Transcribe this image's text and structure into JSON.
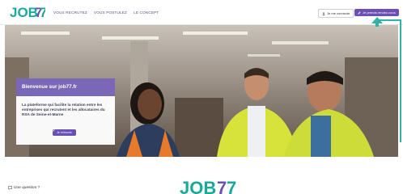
{
  "header": {
    "logo_text": "JOB77",
    "nav": [
      "VOUS RECRUTEZ",
      "VOUS POSTULEZ",
      "LE CONCEPT"
    ],
    "login_label": "Je me connecte",
    "signup_label": "Je prends rendez-vous"
  },
  "hero": {
    "card_title": "Bienvenue sur job77.fr",
    "card_text": "La plateforme qui facilite la relation entre les entreprises qui recrutent et les allocataires du RSA de Seine-et-Marne",
    "card_button": "Je m'inscris"
  },
  "footer": {
    "question_label": "Une question ?",
    "bottom_logo_text": "JOB77"
  },
  "colors": {
    "brand_purple": "#6a4fb4",
    "card_purple": "#7b67b8",
    "teal": "#2fb3a6",
    "logo_teal": "#19a99b"
  }
}
